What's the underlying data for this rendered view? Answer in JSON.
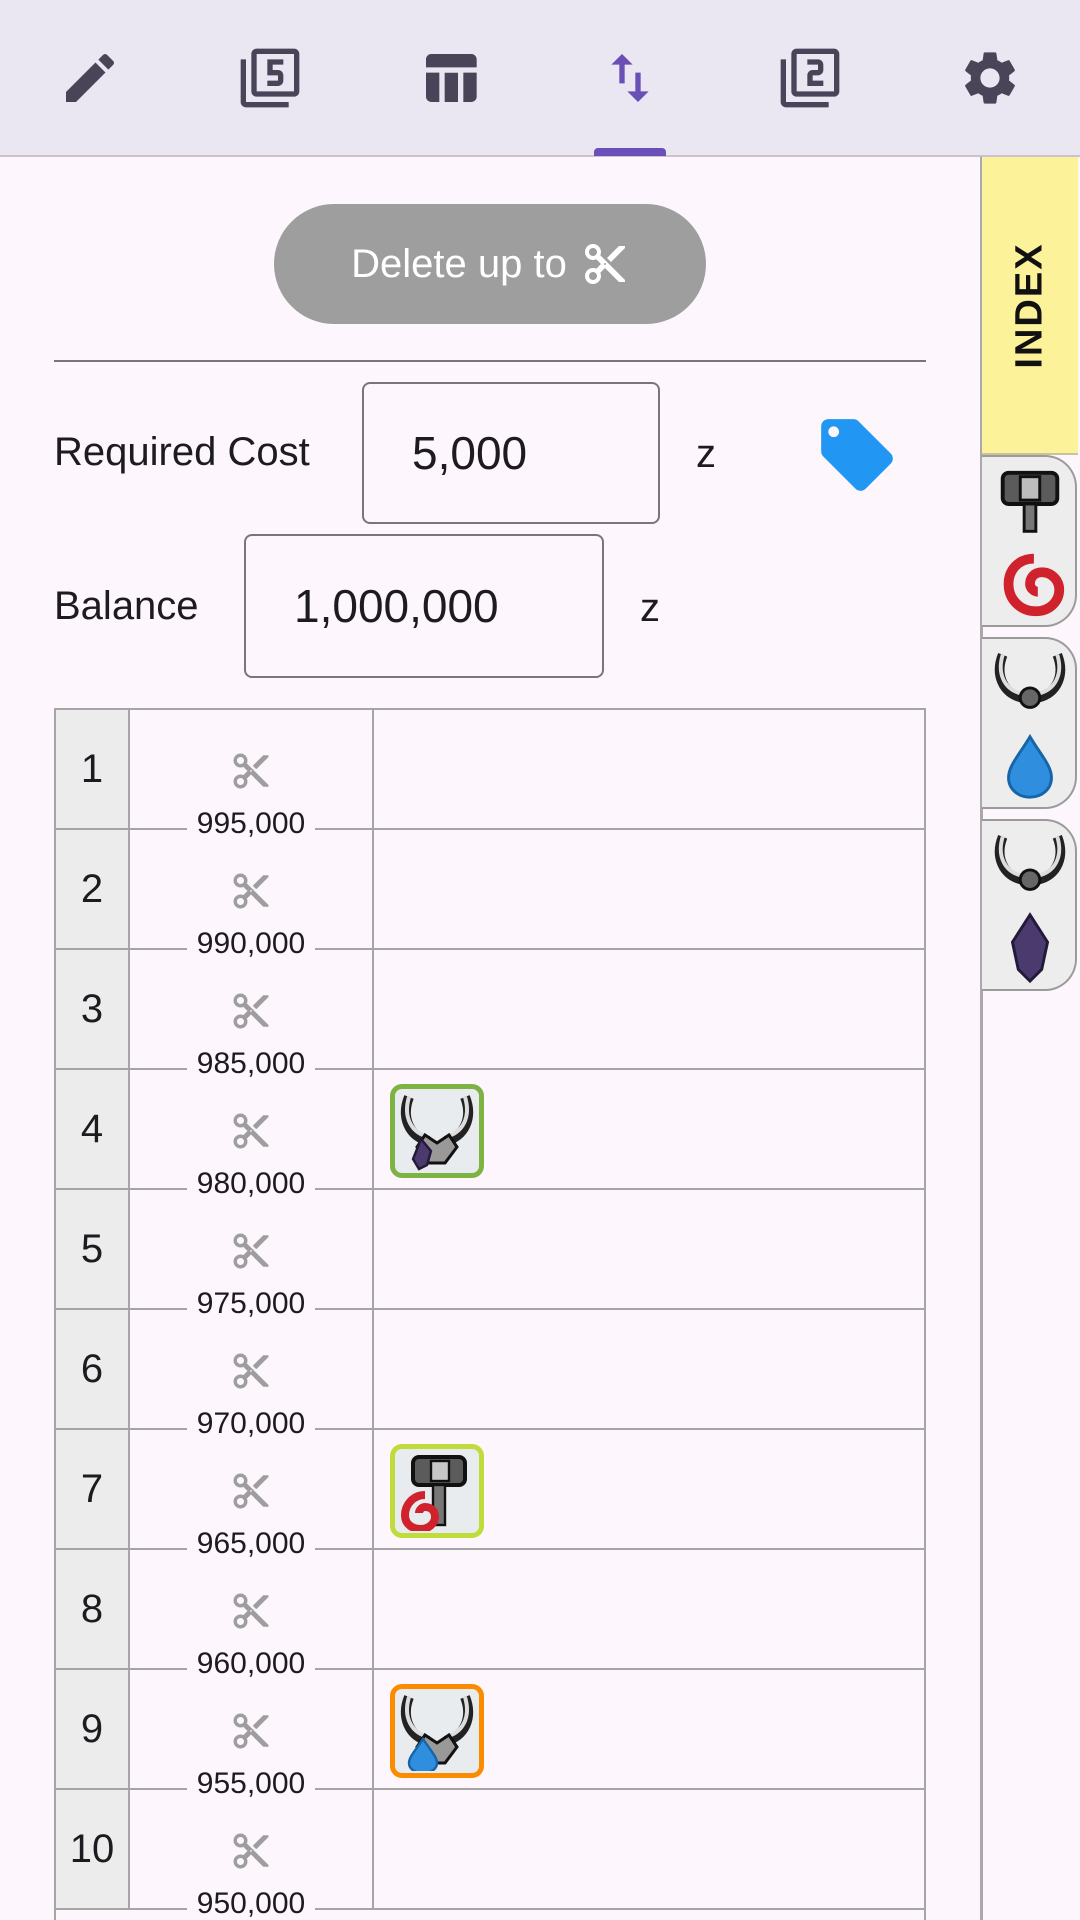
{
  "toolbar": {
    "tabs": [
      {
        "icon": "pencil-icon"
      },
      {
        "icon": "filter-5-icon"
      },
      {
        "icon": "table-icon"
      },
      {
        "icon": "swap-vert-icon",
        "selected": true
      },
      {
        "icon": "filter-2-icon"
      },
      {
        "icon": "gear-icon"
      }
    ],
    "accent_color": "#6a4fb8"
  },
  "side_index": {
    "label": "INDEX",
    "items": [
      {
        "weapon": "hammer-icon",
        "element": "fire-icon"
      },
      {
        "weapon": "horns-icon",
        "element": "water-icon"
      },
      {
        "weapon": "horns-icon",
        "element": "dragon-crystal-icon"
      }
    ]
  },
  "actions": {
    "delete_label": "Delete up to"
  },
  "form": {
    "required_cost_label": "Required Cost",
    "required_cost_value": "5,000",
    "required_cost_unit": "z",
    "balance_label": "Balance",
    "balance_value": "1,000,000",
    "balance_unit": "z",
    "tag_color": "#2196f3"
  },
  "table": {
    "rows": [
      {
        "num": "1",
        "balance": "995,000"
      },
      {
        "num": "2",
        "balance": "990,000"
      },
      {
        "num": "3",
        "balance": "985,000"
      },
      {
        "num": "4",
        "balance": "980,000",
        "item": {
          "icon": "horns-dragon-icon",
          "frame": "#7cb342"
        }
      },
      {
        "num": "5",
        "balance": "975,000"
      },
      {
        "num": "6",
        "balance": "970,000"
      },
      {
        "num": "7",
        "balance": "965,000",
        "item": {
          "icon": "hammer-fire-icon",
          "frame": "#c0dc3a"
        }
      },
      {
        "num": "8",
        "balance": "960,000"
      },
      {
        "num": "9",
        "balance": "955,000",
        "item": {
          "icon": "horns-water-icon",
          "frame": "#fb8c00"
        }
      },
      {
        "num": "10",
        "balance": "950,000"
      }
    ]
  }
}
